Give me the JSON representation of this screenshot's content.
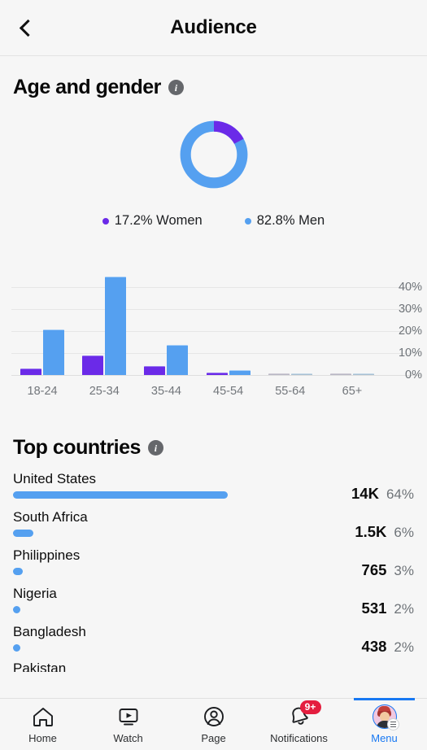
{
  "header": {
    "title": "Audience",
    "back_icon": "chevron-left-icon"
  },
  "age_gender": {
    "title": "Age and gender",
    "info_icon": "info-icon",
    "info_glyph": "i",
    "colors": {
      "women": "#6b2ae8",
      "men": "#55a0f0"
    },
    "legend": [
      {
        "label": "17.2% Women",
        "color": "#6b2ae8"
      },
      {
        "label": "82.8% Men",
        "color": "#55a0f0"
      }
    ],
    "donut": {
      "women_pct": 17.2,
      "men_pct": 82.8
    }
  },
  "chart_data": [
    {
      "type": "pie",
      "title": "Age and gender",
      "labels": [
        "Women",
        "Men"
      ],
      "values": [
        17.2,
        82.8
      ],
      "value_labels": [
        "17.2%",
        "82.8%"
      ],
      "colors": [
        "#6b2ae8",
        "#55a0f0"
      ],
      "legend": "bottom",
      "donut": true
    },
    {
      "type": "bar",
      "title": "",
      "categories": [
        "18-24",
        "25-34",
        "35-44",
        "45-54",
        "55-64",
        "65+"
      ],
      "series": [
        {
          "name": "Women",
          "color": "#6b2ae8",
          "values": [
            3.0,
            8.7,
            4.0,
            1.0,
            0.3,
            0.3
          ]
        },
        {
          "name": "Men",
          "color": "#55a0f0",
          "values": [
            20.7,
            44.7,
            13.7,
            2.3,
            0.3,
            0.5
          ]
        }
      ],
      "xlabel": "",
      "ylabel": "",
      "ylim": [
        0,
        45
      ],
      "yticks": [
        0,
        10,
        20,
        30,
        40
      ],
      "ytick_labels": [
        "0%",
        "10%",
        "20%",
        "30%",
        "40%"
      ],
      "grid": true,
      "legend": "none"
    }
  ],
  "top_countries": {
    "title": "Top countries",
    "info_icon": "info-icon",
    "info_glyph": "i",
    "bar_color": "#55a0f0",
    "rows": [
      {
        "name": "United States",
        "count": "14K",
        "pct": "64%",
        "pct_value": 64
      },
      {
        "name": "South Africa",
        "count": "1.5K",
        "pct": "6%",
        "pct_value": 6
      },
      {
        "name": "Philippines",
        "count": "765",
        "pct": "3%",
        "pct_value": 3
      },
      {
        "name": "Nigeria",
        "count": "531",
        "pct": "2%",
        "pct_value": 2
      },
      {
        "name": "Bangladesh",
        "count": "438",
        "pct": "2%",
        "pct_value": 2
      }
    ],
    "cut_off_row": {
      "name": "Pakistan"
    }
  },
  "bottom_nav": {
    "active": "Menu",
    "active_color": "#1878f2",
    "items": [
      {
        "label": "Home",
        "icon": "home-icon",
        "active": false
      },
      {
        "label": "Watch",
        "icon": "video-play-icon",
        "active": false
      },
      {
        "label": "Page",
        "icon": "profile-circle-icon",
        "active": false
      },
      {
        "label": "Notifications",
        "icon": "bell-icon",
        "badge": "9+",
        "active": false
      },
      {
        "label": "Menu",
        "icon": "avatar-menu-icon",
        "active": true
      }
    ]
  }
}
